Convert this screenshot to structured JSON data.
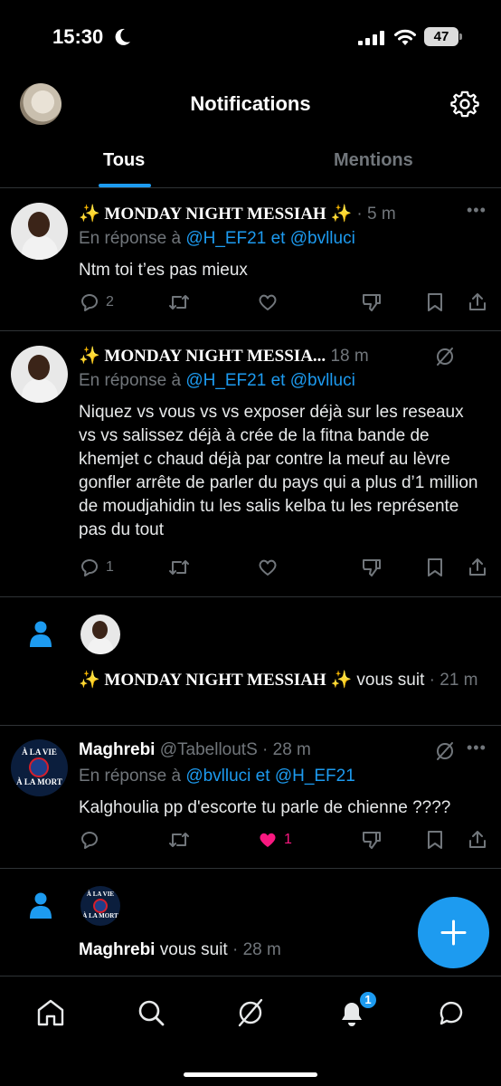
{
  "status_bar": {
    "time": "15:30",
    "battery": "47"
  },
  "header": {
    "title": "Notifications"
  },
  "tabs": [
    {
      "label": "Tous",
      "active": true
    },
    {
      "label": "Mentions",
      "active": false
    }
  ],
  "notifications": [
    {
      "type": "reply",
      "display_name": "✨ MONDAY NIGHT MESSIAH ✨",
      "meta": " · 5 m",
      "reply_prefix": "En réponse à ",
      "mention1": "@H_EF21",
      "reply_join": " et ",
      "mention2": "@bvlluci",
      "text": "Ntm toi t’es pas mieux",
      "reply_count": "2",
      "like_count": ""
    },
    {
      "type": "reply",
      "display_name": "✨ MONDAY NIGHT MESSIA...",
      "meta": " 18 m",
      "reply_prefix": "En réponse à ",
      "mention1": "@H_EF21",
      "reply_join": " et ",
      "mention2": "@bvlluci",
      "text": "Niquez vs vous vs vs exposer déjà sur les reseaux vs vs salissez déjà à crée de la fitna bande de khemjet c chaud déjà par contre la meuf au lèvre gonfler arrête de parler du pays qui a plus d’1 million de moudjahidin tu les salis kelba tu les représente pas du tout",
      "reply_count": "1",
      "like_count": ""
    },
    {
      "type": "follow",
      "display_name": "✨ MONDAY NIGHT MESSIAH ✨",
      "follow_text": " vous suit",
      "meta": " · 21 m"
    },
    {
      "type": "reply",
      "display_name": "Maghrebi",
      "handle": " @TabelloutS",
      "meta": " · 28 m",
      "reply_prefix": "En réponse à ",
      "mention1": "@bvlluci",
      "reply_join": " et ",
      "mention2": "@H_EF21",
      "text": "Kalghoulia pp d'escorte tu parle de chienne ????",
      "reply_count": "",
      "like_count": "1",
      "avatar_text_top": "À LA VIE",
      "avatar_text_bottom": "À LA MORT"
    },
    {
      "type": "follow",
      "display_name": "Maghrebi",
      "follow_text": " vous suit",
      "meta": " · 28 m",
      "avatar_text_top": "À LA VIE",
      "avatar_text_bottom": "À LA MORT"
    }
  ],
  "bottom_nav": {
    "items": [
      "home-icon",
      "search-icon",
      "grok-icon",
      "notifications-icon",
      "messages-icon"
    ],
    "notification_badge": "1"
  },
  "colors": {
    "accent": "#1d9bf0",
    "like": "#f91880",
    "muted": "#71767b",
    "background": "#000000"
  }
}
